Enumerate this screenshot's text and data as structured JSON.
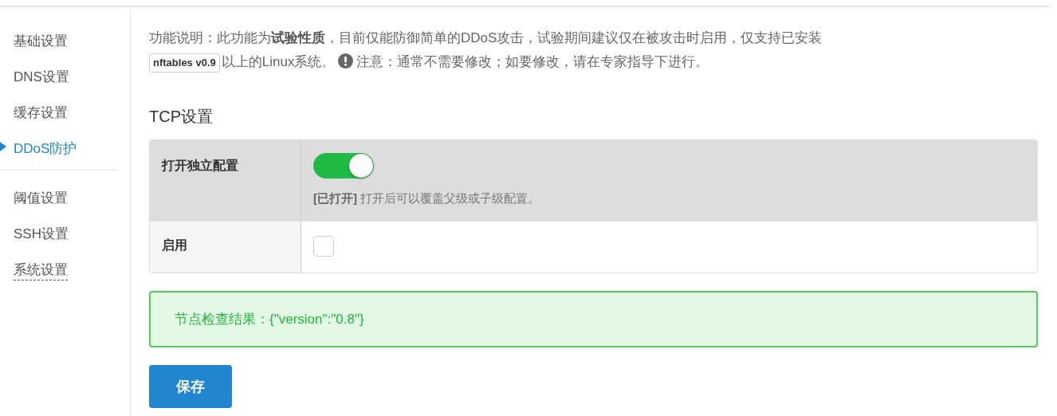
{
  "sidebar": {
    "groups": [
      {
        "items": [
          {
            "label": "基础设置",
            "selected": false,
            "underlined": false
          },
          {
            "label": "DNS设置",
            "selected": false,
            "underlined": false
          },
          {
            "label": "缓存设置",
            "selected": false,
            "underlined": false
          },
          {
            "label": "DDoS防护",
            "selected": true,
            "underlined": false
          }
        ]
      },
      {
        "items": [
          {
            "label": "阈值设置",
            "selected": false,
            "underlined": false
          },
          {
            "label": "SSH设置",
            "selected": false,
            "underlined": false
          },
          {
            "label": "系统设置",
            "selected": false,
            "underlined": true
          }
        ]
      }
    ]
  },
  "description": {
    "intro": "功能说明：此功能为**试验性质**，目前仅能防御简单的DDoS攻击，试验期间建议仅在被攻击时启用，仅支持已安装",
    "badge": "nftables v0.9",
    "after": "以上的Linux系统。",
    "note": "注意：通常不需要修改；如要修改，请在专家指导下进行。"
  },
  "section_title": "TCP设置",
  "form": {
    "rows": [
      {
        "kind": "switch",
        "label": "打开独立配置",
        "on": true,
        "state_text": "[已打开]",
        "hint": "打开后可以覆盖父级或子级配置。"
      },
      {
        "kind": "checkbox",
        "label": "启用",
        "checked": false
      }
    ]
  },
  "alert": {
    "text": "节点检查结果：{\"version\":\"0.8\"}"
  },
  "save_button": "保存"
}
